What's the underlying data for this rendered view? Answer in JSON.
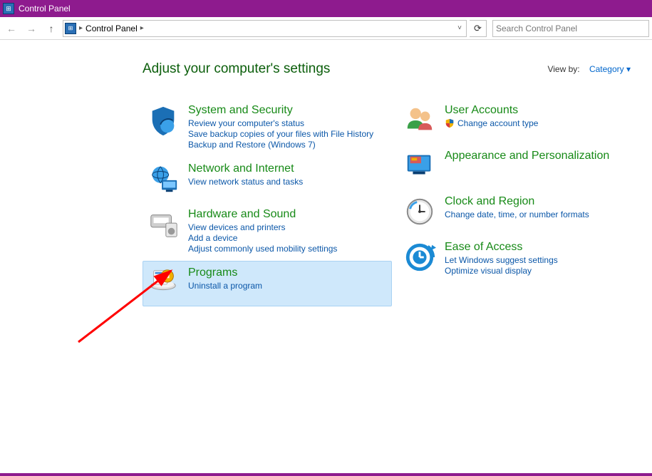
{
  "window": {
    "title": "Control Panel"
  },
  "nav": {
    "breadcrumb": [
      "Control Panel"
    ],
    "search_placeholder": "Search Control Panel"
  },
  "header": {
    "title": "Adjust your computer's settings",
    "view_by_label": "View by:",
    "view_by_value": "Category"
  },
  "categories_left": [
    {
      "id": "system-security",
      "title": "System and Security",
      "links": [
        "Review your computer's status",
        "Save backup copies of your files with File History",
        "Backup and Restore (Windows 7)"
      ]
    },
    {
      "id": "network-internet",
      "title": "Network and Internet",
      "links": [
        "View network status and tasks"
      ]
    },
    {
      "id": "hardware-sound",
      "title": "Hardware and Sound",
      "links": [
        "View devices and printers",
        "Add a device",
        "Adjust commonly used mobility settings"
      ]
    },
    {
      "id": "programs",
      "title": "Programs",
      "links": [
        "Uninstall a program"
      ],
      "selected": true
    }
  ],
  "categories_right": [
    {
      "id": "user-accounts",
      "title": "User Accounts",
      "links": [
        "Change account type"
      ],
      "shield_on_first": true
    },
    {
      "id": "appearance",
      "title": "Appearance and Personalization",
      "links": []
    },
    {
      "id": "clock-region",
      "title": "Clock and Region",
      "links": [
        "Change date, time, or number formats"
      ]
    },
    {
      "id": "ease-of-access",
      "title": "Ease of Access",
      "links": [
        "Let Windows suggest settings",
        "Optimize visual display"
      ]
    }
  ]
}
